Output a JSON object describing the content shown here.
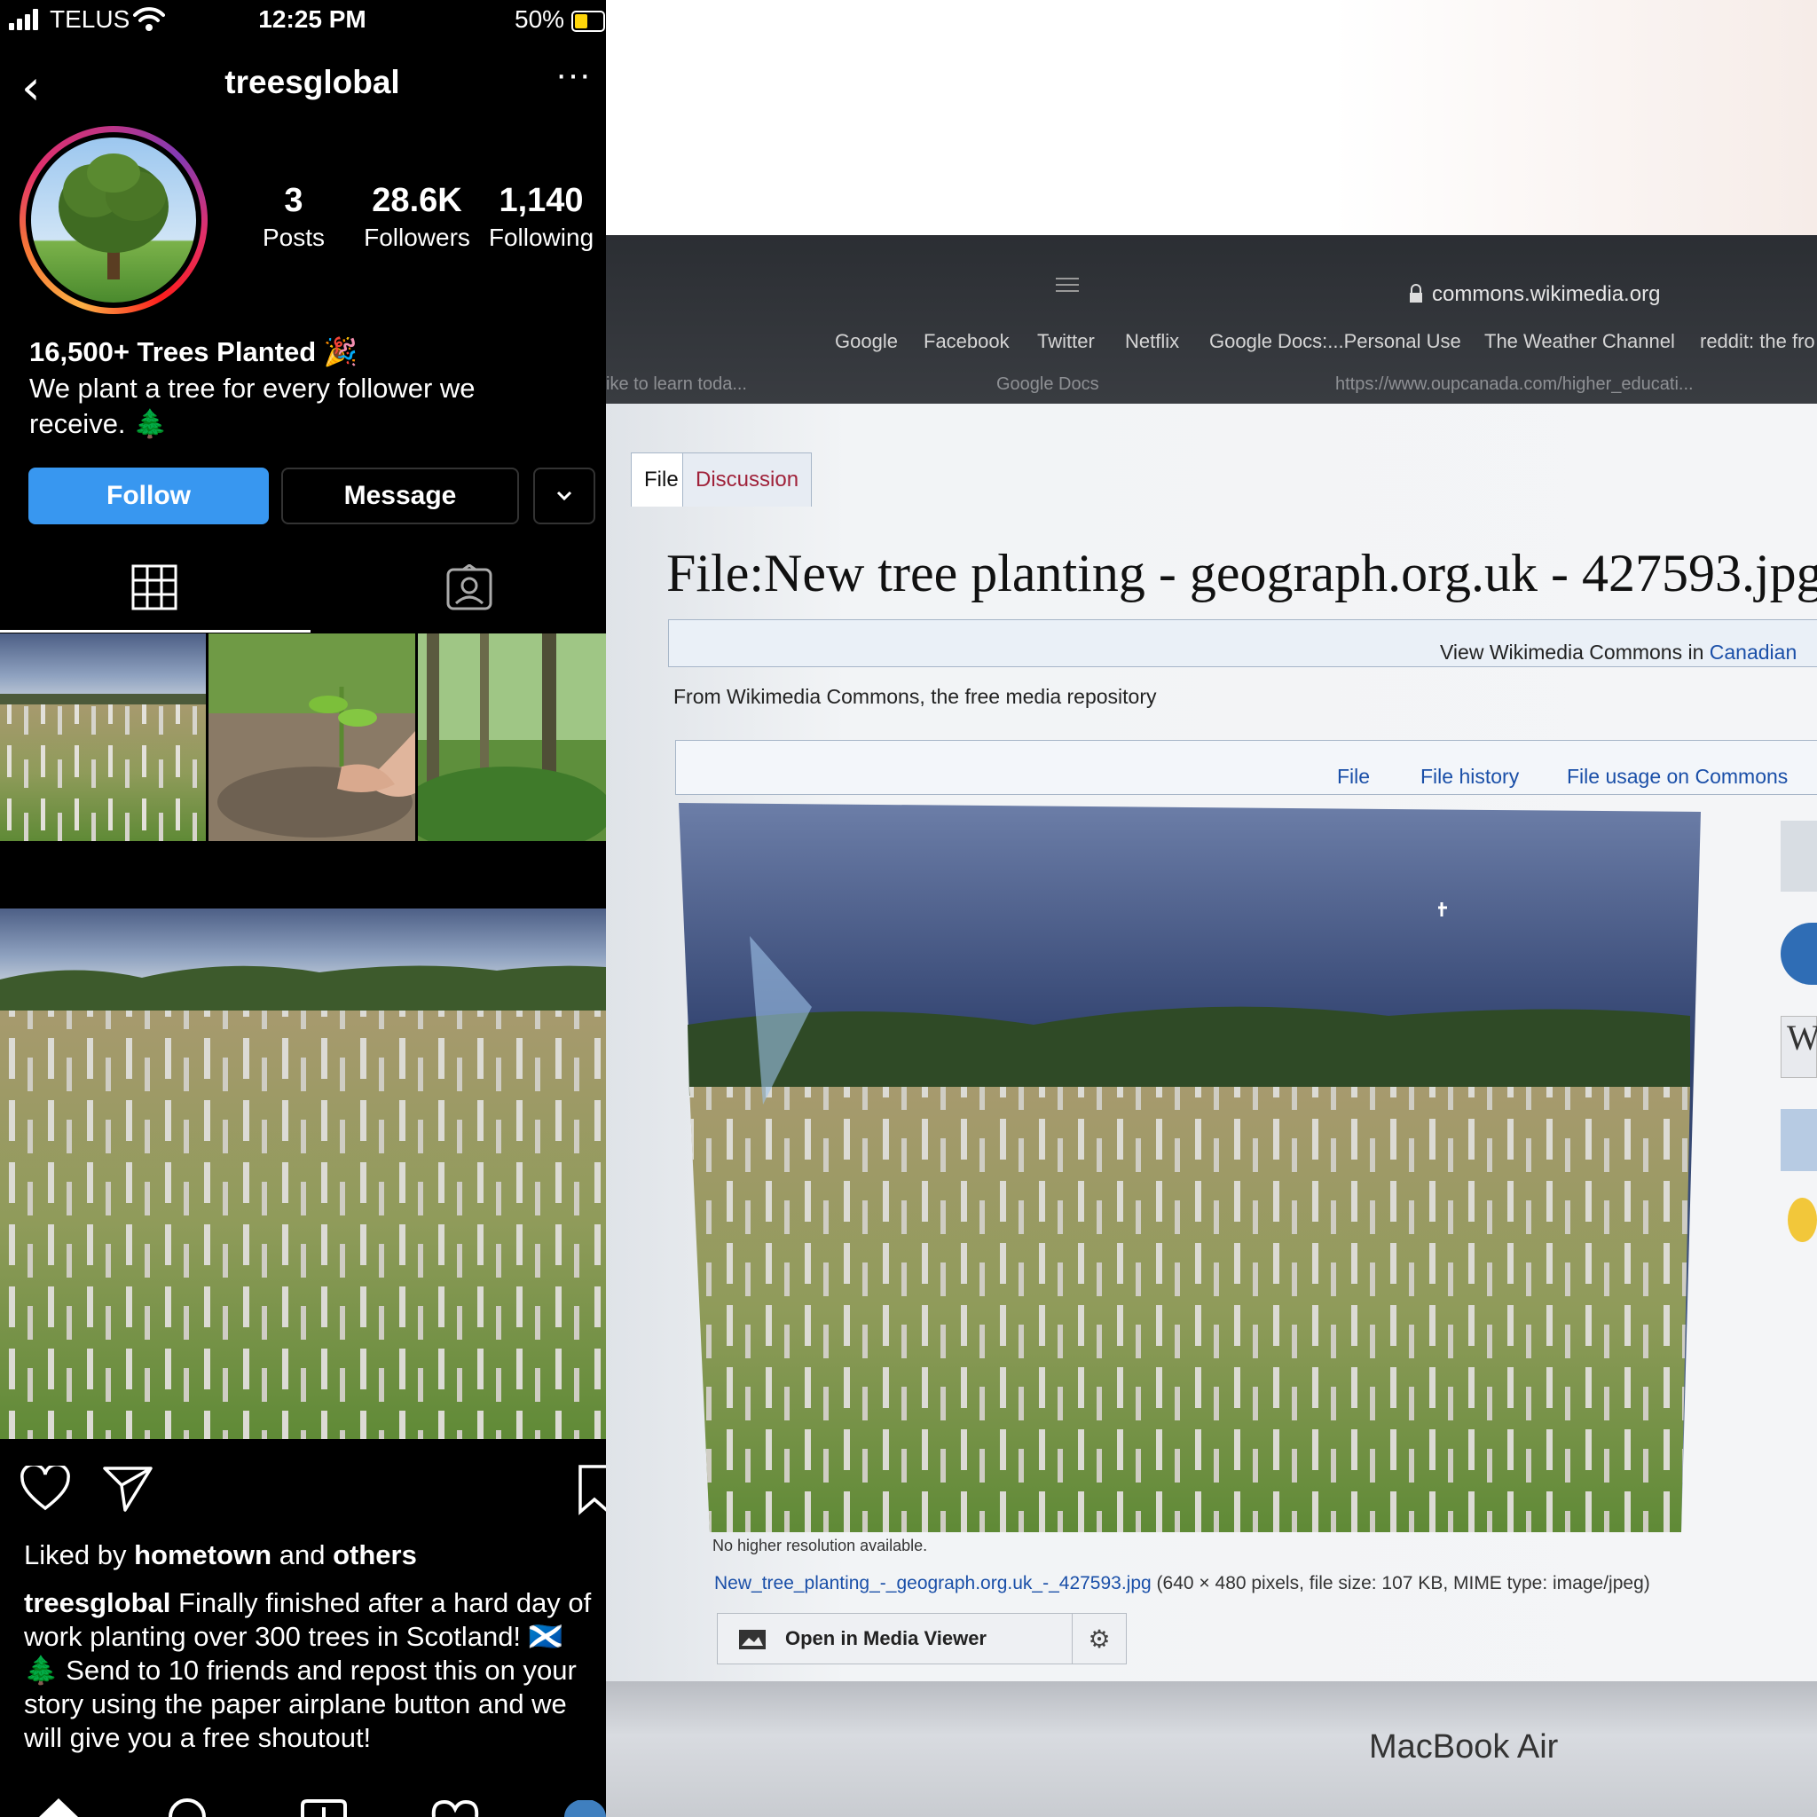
{
  "phone": {
    "status": {
      "carrier": "TELUS",
      "time": "12:25 PM",
      "battery": "50%"
    },
    "profile": {
      "username": "treesglobal",
      "stats": [
        {
          "value": "3",
          "label": "Posts"
        },
        {
          "value": "28.6K",
          "label": "Followers"
        },
        {
          "value": "1,140",
          "label": "Following"
        }
      ],
      "bio_title": "16,500+ Trees Planted 🎉",
      "bio_text": "We plant a tree for every follower we receive. 🌲",
      "follow_label": "Follow",
      "message_label": "Message"
    },
    "post": {
      "liked_prefix": "Liked by",
      "liked_user": "hometown",
      "liked_and": "and",
      "liked_others": "others",
      "caption_user": "treesglobal",
      "caption_text": "Finally finished after a hard day of work planting over 300 trees in Scotland! 🏴󠁧󠁢󠁳󠁣󠁴󠁿 🌲  Send to 10 friends and repost this on your story using the paper airplane button and we will give you a free shoutout!"
    },
    "colors": {
      "follow": "#3897f0",
      "background": "#000000"
    }
  },
  "laptop": {
    "url": "commons.wikimedia.org",
    "bookmarks": [
      "Google",
      "Facebook",
      "Twitter",
      "Netflix",
      "Google Docs:...Personal Use",
      "The Weather Channel",
      "reddit: the fro"
    ],
    "tabs_row": [
      "ike to learn toda...",
      "Google Docs",
      "https://www.oupcanada.com/higher_educati..."
    ],
    "wiki_tabs": [
      "File",
      "Discussion"
    ],
    "file_title": "File:New tree planting - geograph.org.uk - 427593.jpg",
    "view_in": "View Wikimedia Commons in",
    "view_lang": "Canadian",
    "from_line": "From Wikimedia Commons, the free media repository",
    "file_links": [
      "File",
      "File history",
      "File usage on Commons"
    ],
    "no_higher": "No higher resolution available.",
    "file_name": "New_tree_planting_-_geograph.org.uk_-_427593.jpg",
    "file_info": "(640 × 480 pixels, file size: 107 KB, MIME type: image/jpeg)",
    "open_media_viewer": "Open in Media Viewer",
    "brand": "MacBook Air"
  }
}
